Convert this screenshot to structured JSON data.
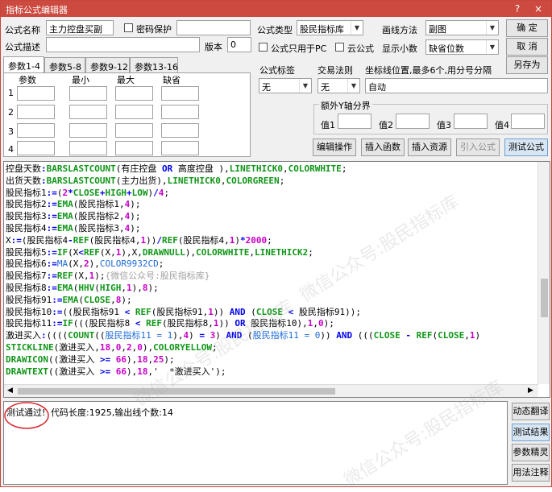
{
  "window": {
    "title": "指标公式编辑器",
    "help_glyph": "?",
    "close_glyph": "×"
  },
  "form": {
    "name_label": "公式名称",
    "name_value": "主力控盘买副",
    "password_label": "密码保护",
    "desc_label": "公式描述",
    "desc_value": "",
    "version_label": "版本",
    "version_value": "0",
    "type_label": "公式类型",
    "type_value": "股民指标库",
    "draw_label": "画线方法",
    "draw_value": "副图",
    "pc_only_label": "公式只用于PC",
    "cloud_label": "云公式",
    "decimals_label": "显示小数",
    "decimals_value": "缺省位数",
    "tag_label": "公式标签",
    "tag_value": "无",
    "trade_label": "交易法则",
    "trade_value": "无",
    "coord_label": "坐标线位置,最多6个,用分号分隔",
    "coord_value": "自动",
    "yaxis_label": "额外Y轴分界",
    "y_values": [
      "值1",
      "值2",
      "值3",
      "值4"
    ]
  },
  "buttons": {
    "ok": "确  定",
    "cancel": "取  消",
    "save_as": "另存为",
    "edit_op": "编辑操作",
    "insert_func": "插入函数",
    "insert_res": "插入资源",
    "import_formula": "引入公式",
    "test_formula": "测试公式"
  },
  "param_tabs": [
    "参数1-4",
    "参数5-8",
    "参数9-12",
    "参数13-16"
  ],
  "param_headers": [
    "参数",
    "最小",
    "最大",
    "缺省"
  ],
  "param_rows": [
    "1",
    "2",
    "3",
    "4"
  ],
  "output": {
    "status": "测试通过!",
    "info": "代码长度:1925,输出线个数:14"
  },
  "side_buttons": [
    "动态翻译",
    "测试结果",
    "参数精灵",
    "用法注释"
  ],
  "watermark": "微信公众号:股民指标库",
  "code_lines": [
    [
      [
        "t",
        "控盘天数"
      ],
      [
        "op",
        ":"
      ],
      [
        "fn",
        "BARSLASTCOUNT"
      ],
      [
        "t",
        "(有庄控盘 "
      ],
      [
        "kw",
        "OR"
      ],
      [
        "t",
        " 高度控盘 ),"
      ],
      [
        "fn",
        "LINETHICK0"
      ],
      [
        "t",
        ","
      ],
      [
        "fn",
        "COLORWHITE"
      ],
      [
        "t",
        ";"
      ]
    ],
    [
      [
        "t",
        "出货天数"
      ],
      [
        "op",
        ":"
      ],
      [
        "fn",
        "BARSLASTCOUNT"
      ],
      [
        "t",
        "(主力出货),"
      ],
      [
        "fn",
        "LINETHICK0"
      ],
      [
        "t",
        ","
      ],
      [
        "fn",
        "COLORGREEN"
      ],
      [
        "t",
        ";"
      ]
    ],
    [
      [
        "t",
        "股民指标1"
      ],
      [
        "op",
        ":="
      ],
      [
        "t",
        "("
      ],
      [
        "num",
        "2"
      ],
      [
        "op",
        "*"
      ],
      [
        "fn",
        "CLOSE"
      ],
      [
        "op",
        "+"
      ],
      [
        "fn",
        "HIGH"
      ],
      [
        "op",
        "+"
      ],
      [
        "fn",
        "LOW"
      ],
      [
        "t",
        ")"
      ],
      [
        "op",
        "/"
      ],
      [
        "num",
        "4"
      ],
      [
        "t",
        ";"
      ]
    ],
    [
      [
        "t",
        "股民指标2"
      ],
      [
        "op",
        ":="
      ],
      [
        "fn",
        "EMA"
      ],
      [
        "t",
        "(股民指标1,"
      ],
      [
        "num",
        "4"
      ],
      [
        "t",
        ");"
      ]
    ],
    [
      [
        "t",
        "股民指标3"
      ],
      [
        "op",
        ":="
      ],
      [
        "fn",
        "EMA"
      ],
      [
        "t",
        "(股民指标2,"
      ],
      [
        "num",
        "4"
      ],
      [
        "t",
        ");"
      ]
    ],
    [
      [
        "t",
        "股民指标4"
      ],
      [
        "op",
        ":="
      ],
      [
        "fn",
        "EMA"
      ],
      [
        "t",
        "(股民指标3,"
      ],
      [
        "num",
        "4"
      ],
      [
        "t",
        ");"
      ]
    ],
    [
      [
        "t",
        "X"
      ],
      [
        "op",
        ":="
      ],
      [
        "t",
        "(股民指标4"
      ],
      [
        "op",
        "-"
      ],
      [
        "fn",
        "REF"
      ],
      [
        "t",
        "(股民指标4,"
      ],
      [
        "num",
        "1"
      ],
      [
        "t",
        "))"
      ],
      [
        "op",
        "/"
      ],
      [
        "fn",
        "REF"
      ],
      [
        "t",
        "(股民指标4,"
      ],
      [
        "num",
        "1"
      ],
      [
        "t",
        ")"
      ],
      [
        "op",
        "*"
      ],
      [
        "num",
        "2000"
      ],
      [
        "t",
        ";"
      ]
    ],
    [
      [
        "t",
        "股民指标5"
      ],
      [
        "op",
        ":="
      ],
      [
        "fn",
        "IF"
      ],
      [
        "t",
        "(X"
      ],
      [
        "op",
        "<"
      ],
      [
        "fn",
        "REF"
      ],
      [
        "t",
        "(X,"
      ],
      [
        "num",
        "1"
      ],
      [
        "t",
        "),X,"
      ],
      [
        "fn",
        "DRAWNULL"
      ],
      [
        "t",
        "),"
      ],
      [
        "fn",
        "COLORWHITE"
      ],
      [
        "t",
        ","
      ],
      [
        "fn",
        "LINETHICK2"
      ],
      [
        "t",
        ";"
      ]
    ],
    [
      [
        "t",
        "股民指标6"
      ],
      [
        "op",
        ":="
      ],
      [
        "c",
        "MA"
      ],
      [
        "t",
        "(X,"
      ],
      [
        "num",
        "2"
      ],
      [
        "t",
        "),"
      ],
      [
        "c",
        "COLOR9932CD"
      ],
      [
        "t",
        ";"
      ]
    ],
    [
      [
        "t",
        "股民指标7"
      ],
      [
        "op",
        ":="
      ],
      [
        "fn",
        "REF"
      ],
      [
        "t",
        "(X,"
      ],
      [
        "num",
        "1"
      ],
      [
        "t",
        ");"
      ],
      [
        "cm",
        "{微信公众号:股民指标库}"
      ]
    ],
    [
      [
        "t",
        "股民指标8"
      ],
      [
        "op",
        ":="
      ],
      [
        "fn",
        "EMA"
      ],
      [
        "t",
        "("
      ],
      [
        "fn",
        "HHV"
      ],
      [
        "t",
        "("
      ],
      [
        "fn",
        "HIGH"
      ],
      [
        "t",
        ","
      ],
      [
        "num",
        "1"
      ],
      [
        "t",
        "),"
      ],
      [
        "num",
        "8"
      ],
      [
        "t",
        ");"
      ]
    ],
    [
      [
        "t",
        "股民指标91"
      ],
      [
        "op",
        ":="
      ],
      [
        "fn",
        "EMA"
      ],
      [
        "t",
        "("
      ],
      [
        "fn",
        "CLOSE"
      ],
      [
        "t",
        ","
      ],
      [
        "num",
        "8"
      ],
      [
        "t",
        ");"
      ]
    ],
    [
      [
        "t",
        "股民指标10"
      ],
      [
        "op",
        ":="
      ],
      [
        "t",
        "((股民指标91 "
      ],
      [
        "op",
        "<"
      ],
      [
        "t",
        " "
      ],
      [
        "fn",
        "REF"
      ],
      [
        "t",
        "(股民指标91,"
      ],
      [
        "num",
        "1"
      ],
      [
        "t",
        ")) "
      ],
      [
        "kw",
        "AND"
      ],
      [
        "t",
        " ("
      ],
      [
        "fn",
        "CLOSE"
      ],
      [
        "t",
        " "
      ],
      [
        "op",
        "<"
      ],
      [
        "t",
        " 股民指标91));"
      ]
    ],
    [
      [
        "t",
        "股民指标11"
      ],
      [
        "op",
        ":="
      ],
      [
        "fn",
        "IF"
      ],
      [
        "t",
        "(((股民指标8 "
      ],
      [
        "op",
        "<"
      ],
      [
        "t",
        " "
      ],
      [
        "fn",
        "REF"
      ],
      [
        "t",
        "(股民指标8,"
      ],
      [
        "num",
        "1"
      ],
      [
        "t",
        ")) "
      ],
      [
        "kw",
        "OR"
      ],
      [
        "t",
        " 股民指标10),"
      ],
      [
        "num",
        "1"
      ],
      [
        "t",
        ","
      ],
      [
        "num",
        "0"
      ],
      [
        "t",
        ");"
      ]
    ],
    [
      [
        "t",
        "激进买入"
      ],
      [
        "op",
        ":"
      ],
      [
        "t",
        "(((("
      ],
      [
        "fn",
        "COUNT"
      ],
      [
        "t",
        "(("
      ],
      [
        "c",
        "股民指标11 = 1"
      ],
      [
        "t",
        "),"
      ],
      [
        "num",
        "4"
      ],
      [
        "t",
        ") "
      ],
      [
        "op",
        "="
      ],
      [
        "t",
        " "
      ],
      [
        "num",
        "3"
      ],
      [
        "t",
        ") "
      ],
      [
        "kw",
        "AND"
      ],
      [
        "t",
        " ("
      ],
      [
        "c",
        "股民指标11 = 0"
      ],
      [
        "t",
        ")) "
      ],
      [
        "kw",
        "AND"
      ],
      [
        "t",
        " ((("
      ],
      [
        "fn",
        "CLOSE"
      ],
      [
        "t",
        " "
      ],
      [
        "op",
        "-"
      ],
      [
        "t",
        " "
      ],
      [
        "fn",
        "REF"
      ],
      [
        "t",
        "("
      ],
      [
        "fn",
        "CLOSE"
      ],
      [
        "t",
        ","
      ],
      [
        "num",
        "1"
      ],
      [
        "t",
        ")"
      ]
    ],
    [
      [
        "fn",
        "STICKLINE"
      ],
      [
        "t",
        "(激进买入,"
      ],
      [
        "num",
        "18"
      ],
      [
        "t",
        ","
      ],
      [
        "num",
        "0"
      ],
      [
        "t",
        ","
      ],
      [
        "num",
        "2"
      ],
      [
        "t",
        ","
      ],
      [
        "num",
        "0"
      ],
      [
        "t",
        "),"
      ],
      [
        "fn",
        "COLORYELLOW"
      ],
      [
        "t",
        ";"
      ]
    ],
    [
      [
        "fn",
        "DRAWICON"
      ],
      [
        "t",
        "((激进买入 "
      ],
      [
        "op",
        ">="
      ],
      [
        "t",
        " "
      ],
      [
        "num",
        "66"
      ],
      [
        "t",
        "),"
      ],
      [
        "num",
        "18"
      ],
      [
        "t",
        ","
      ],
      [
        "num",
        "25"
      ],
      [
        "t",
        ");"
      ]
    ],
    [
      [
        "fn",
        "DRAWTEXT"
      ],
      [
        "t",
        "((激进买入 "
      ],
      [
        "op",
        ">="
      ],
      [
        "t",
        " "
      ],
      [
        "num",
        "66"
      ],
      [
        "t",
        "),"
      ],
      [
        "num",
        "18"
      ],
      [
        "t",
        ",'  *激进买入');"
      ]
    ]
  ]
}
